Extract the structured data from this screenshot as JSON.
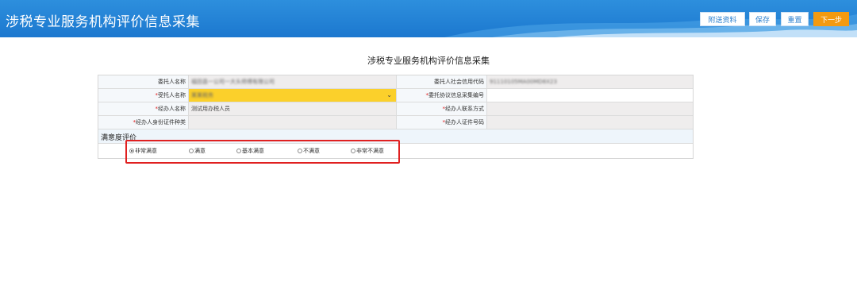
{
  "header": {
    "title": "涉税专业服务机构评价信息采集",
    "buttons": {
      "attachments": "附送资料",
      "save": "保存",
      "reset": "重置",
      "next": "下一步"
    }
  },
  "page_title": "涉税专业服务机构评价信息采集",
  "form": {
    "row1": {
      "label_left": "委托人名称",
      "value_left": "福田县一公司一大头师傅有限公司",
      "label_right": "委托人社会信用代码",
      "value_right": "91110105MA00MD8X23"
    },
    "row2": {
      "label_left": "受托人名称",
      "value_left": "某某税务",
      "label_right": "委托协议信息采集编号",
      "value_right": ""
    },
    "row3": {
      "label_left": "经办人名称",
      "value_left": "测试用办税人员",
      "label_right": "经办人联系方式",
      "value_right": ""
    },
    "row4": {
      "label_left": "经办人身份证件种类",
      "value_left": "",
      "label_right": "经办人证件号码",
      "value_right": ""
    }
  },
  "satisfaction": {
    "title": "满意度评价",
    "options": [
      "非常满意",
      "满意",
      "基本满意",
      "不满意",
      "非常不满意"
    ],
    "selected": "非常满意"
  },
  "required_mark": "*",
  "colors": {
    "header": "#1c78cf",
    "next_button": "#f39a11",
    "highlight": "#e02020",
    "selected_field": "#fbd02b"
  }
}
